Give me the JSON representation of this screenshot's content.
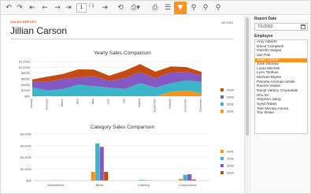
{
  "toolbar": {
    "page_value": "1",
    "page_total": "/ 1",
    "icons": [
      "undo-icon",
      "redo-icon",
      "first-page-icon",
      "prev-page-icon",
      "next-page-icon",
      "last-page-icon",
      "refresh-icon",
      "export-icon",
      "print-icon",
      "settings-icon",
      "filter-icon",
      "zoom-in-icon",
      "zoom-out-icon",
      "zoom-fit-icon"
    ]
  },
  "report": {
    "header_label": "SALES REPORT",
    "employee_name": "Jillian Carson",
    "date": "Jul 2003"
  },
  "colors": {
    "accent": "#f7931e",
    "s2001": "#f7931e",
    "s2002": "#3bb6c9",
    "s2003": "#8559c3",
    "s2004": "#c44b12"
  },
  "chart_data": [
    {
      "type": "area",
      "title": "Yearly Sales Comparison",
      "categories": [
        "January",
        "February",
        "March",
        "April",
        "May",
        "June",
        "July",
        "August",
        "September",
        "October",
        "November",
        "December"
      ],
      "series": [
        {
          "name": "2004",
          "values": [
            80,
            180,
            170,
            280,
            220,
            180,
            250,
            280,
            220,
            200,
            160,
            120
          ]
        },
        {
          "name": "2003",
          "values": [
            200,
            300,
            350,
            250,
            350,
            230,
            380,
            380,
            330,
            380,
            300,
            220
          ]
        },
        {
          "name": "2002",
          "values": [
            300,
            200,
            250,
            400,
            350,
            300,
            250,
            450,
            300,
            300,
            350,
            400
          ]
        },
        {
          "name": "2001",
          "values": [
            0,
            0,
            0,
            0,
            0,
            0,
            0,
            0,
            0,
            150,
            200,
            100
          ]
        }
      ],
      "yticks": [
        "$1,200K",
        "$1,000K",
        "$800K",
        "$600K",
        "$400K",
        "$200K",
        "$0K"
      ],
      "ylim": [
        0,
        1200
      ],
      "legend": "right"
    },
    {
      "type": "bar",
      "title": "Category Sales Comparison",
      "categories": [
        "Accessories",
        "Bikes",
        "Clothing",
        "Components"
      ],
      "series": [
        {
          "name": "2001",
          "values": [
            0,
            1500,
            0,
            300
          ]
        },
        {
          "name": "2002",
          "values": [
            40,
            6400,
            120,
            1000
          ]
        },
        {
          "name": "2003",
          "values": [
            20,
            5800,
            80,
            1100
          ]
        },
        {
          "name": "2004",
          "values": [
            10,
            1500,
            50,
            200
          ]
        }
      ],
      "yticks": [
        "$8,000K",
        "$6,000K",
        "$4,000K",
        "$2,000K",
        "$0K"
      ],
      "ylim": [
        0,
        8000
      ],
      "legend": "right"
    }
  ],
  "panel": {
    "date_label": "Report Date",
    "date_value": "7/1/2003",
    "employee_label": "Employee",
    "employees": [
      "Amy Alberts",
      "David Campbell",
      "Garrett Vargas",
      "Jae Pak",
      "Jillian Carson",
      "José Saraiva",
      "Linda Mitchell",
      "Lynn Tsoflias",
      "Michael Blythe",
      "Pamela Ansman-Wolfe",
      "Rachel Valdez",
      "Ranjit Varkey Chudukatil",
      "Shu Ito",
      "Stephen Jiang",
      "Syed Abbas",
      "Tete Mensa-Annan",
      "Tsvi Reiter"
    ],
    "selected_employee": "Jillian Carson"
  }
}
